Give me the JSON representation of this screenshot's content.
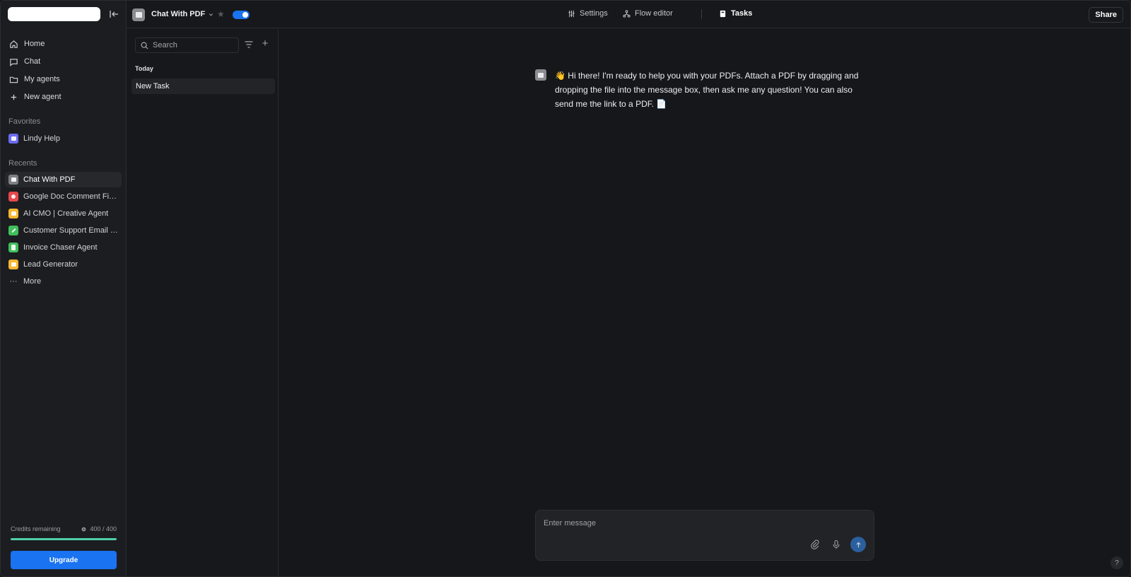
{
  "topbar": {
    "agent_name": "Chat With PDF",
    "tabs": [
      "Settings",
      "Flow editor",
      "Tasks"
    ],
    "share_label": "Share",
    "toggle_on": true
  },
  "sidebar": {
    "nav": [
      "Home",
      "Chat",
      "My agents",
      "New agent"
    ],
    "favorites_label": "Favorites",
    "favorites": [
      {
        "label": "Lindy Help",
        "color": "#6b6cf2"
      }
    ],
    "recents_label": "Recents",
    "recents": [
      {
        "label": "Chat With PDF",
        "color": "#7d7f85",
        "active": true
      },
      {
        "label": "Google Doc Comment Fixer",
        "color": "#e5484d"
      },
      {
        "label": "AI CMO | Creative Agent",
        "color": "#f5b731"
      },
      {
        "label": "Customer Support Email R...",
        "color": "#3fbf5b"
      },
      {
        "label": "Invoice Chaser Agent",
        "color": "#3fbf5b"
      },
      {
        "label": "Lead Generator",
        "color": "#f5b731"
      }
    ],
    "more_label": "More",
    "credits_label": "Credits remaining",
    "credits_value": "400 / 400",
    "credits_fraction": 1.0,
    "upgrade_label": "Upgrade"
  },
  "tasks": {
    "search_placeholder": "Search",
    "group_label": "Today",
    "items": [
      "New Task"
    ]
  },
  "chat": {
    "message": "👋 Hi there! I'm ready to help you with your PDFs. Attach a PDF by dragging and dropping the file into the message box, then ask me any question! You can also send me the link to a PDF. 📄",
    "composer_placeholder": "Enter message"
  },
  "help_label": "?"
}
